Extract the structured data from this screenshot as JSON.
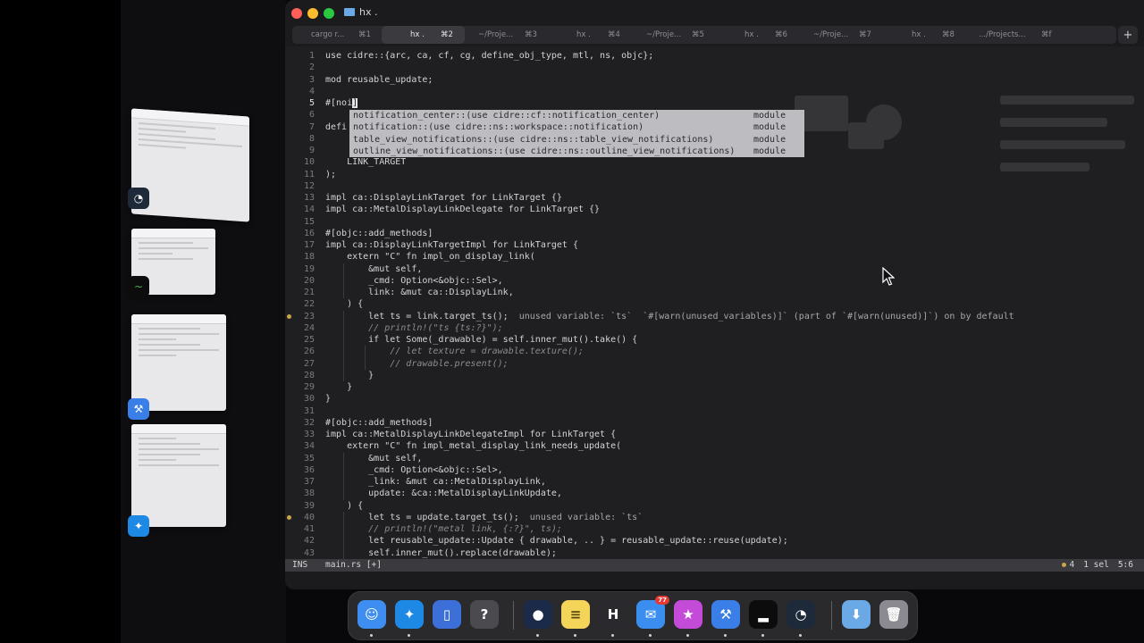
{
  "window": {
    "title": "hx .",
    "new_tab_label": "+"
  },
  "tabs": [
    {
      "label": "cargo r...",
      "shortcut": "⌘1",
      "active": false
    },
    {
      "label": "hx .",
      "shortcut": "⌘2",
      "active": true
    },
    {
      "label": "~/Proje...",
      "shortcut": "⌘3",
      "active": false
    },
    {
      "label": "hx .",
      "shortcut": "⌘4",
      "active": false
    },
    {
      "label": "~/Proje...",
      "shortcut": "⌘5",
      "active": false
    },
    {
      "label": "hx .",
      "shortcut": "⌘6",
      "active": false
    },
    {
      "label": "~/Proje...",
      "shortcut": "⌘7",
      "active": false
    },
    {
      "label": "hx .",
      "shortcut": "⌘8",
      "active": false
    },
    {
      "label": ".../Projects...",
      "shortcut": "⌘f",
      "active": false
    }
  ],
  "code_lines": [
    {
      "n": "1",
      "text": "use cidre::{arc, ca, cf, cg, define_obj_type, mtl, ns, objc};"
    },
    {
      "n": "2",
      "text": ""
    },
    {
      "n": "3",
      "text": "mod reusable_update;"
    },
    {
      "n": "4",
      "text": ""
    },
    {
      "n": "5",
      "text": "#[noi",
      "cursor": "]"
    },
    {
      "n": "6",
      "text": ""
    },
    {
      "n": "7",
      "text": "defi"
    },
    {
      "n": "8",
      "text": ""
    },
    {
      "n": "9",
      "text": ""
    },
    {
      "n": "10",
      "text": "    LINK_TARGET"
    },
    {
      "n": "11",
      "text": ");"
    },
    {
      "n": "12",
      "text": ""
    },
    {
      "n": "13",
      "text": "impl ca::DisplayLinkTarget for LinkTarget {}"
    },
    {
      "n": "14",
      "text": "impl ca::MetalDisplayLinkDelegate for LinkTarget {}"
    },
    {
      "n": "15",
      "text": ""
    },
    {
      "n": "16",
      "text": "#[objc::add_methods]"
    },
    {
      "n": "17",
      "text": "impl ca::DisplayLinkTargetImpl for LinkTarget {"
    },
    {
      "n": "18",
      "text": "    extern \"C\" fn impl_on_display_link("
    },
    {
      "n": "19",
      "text": "        &mut self,"
    },
    {
      "n": "20",
      "text": "        _cmd: Option<&objc::Sel>,"
    },
    {
      "n": "21",
      "text": "        link: &mut ca::DisplayLink,"
    },
    {
      "n": "22",
      "text": "    ) {"
    },
    {
      "n": "23",
      "text": "        let ts = link.target_ts();",
      "hint": "  unused variable: `ts`  `#[warn(unused_variables)]` (part of `#[warn(unused)]`) on by default",
      "diag": true
    },
    {
      "n": "24",
      "text": "        // println!(\"ts {ts:?}\");"
    },
    {
      "n": "25",
      "text": "        if let Some(_drawable) = self.inner_mut().take() {"
    },
    {
      "n": "26",
      "text": "            // let texture = drawable.texture();"
    },
    {
      "n": "27",
      "text": "            // drawable.present();"
    },
    {
      "n": "28",
      "text": "        }"
    },
    {
      "n": "29",
      "text": "    }"
    },
    {
      "n": "30",
      "text": "}"
    },
    {
      "n": "31",
      "text": ""
    },
    {
      "n": "32",
      "text": "#[objc::add_methods]"
    },
    {
      "n": "33",
      "text": "impl ca::MetalDisplayLinkDelegateImpl for LinkTarget {"
    },
    {
      "n": "34",
      "text": "    extern \"C\" fn impl_metal_display_link_needs_update("
    },
    {
      "n": "35",
      "text": "        &mut self,"
    },
    {
      "n": "36",
      "text": "        _cmd: Option<&objc::Sel>,"
    },
    {
      "n": "37",
      "text": "        _link: &mut ca::MetalDisplayLink,"
    },
    {
      "n": "38",
      "text": "        update: &ca::MetalDisplayLinkUpdate,"
    },
    {
      "n": "39",
      "text": "    ) {"
    },
    {
      "n": "40",
      "text": "        let ts = update.target_ts();",
      "hint": "  unused variable: `ts`",
      "diag": true
    },
    {
      "n": "41",
      "text": "        // println!(\"metal link, {:?}\", ts);"
    },
    {
      "n": "42",
      "text": "        let reusable_update::Update { drawable, .. } = reusable_update::reuse(update);"
    },
    {
      "n": "43",
      "text": "        self.inner_mut().replace(drawable);"
    }
  ],
  "completion": [
    {
      "label": "notification_center::(use cidre::cf::notification_center)",
      "kind": "module"
    },
    {
      "label": "notification::(use cidre::ns::workspace::notification)",
      "kind": "module"
    },
    {
      "label": "table_view_notifications::(use cidre::ns::table_view_notifications)",
      "kind": "module"
    },
    {
      "label": "outline_view_notifications::(use cidre::ns::outline_view_notifications)",
      "kind": "module"
    }
  ],
  "status": {
    "mode": "INS",
    "file": "main.rs",
    "modified": "[+]",
    "warnings": "4",
    "selections": "1 sel",
    "position": "5:6"
  },
  "dock": {
    "items": [
      {
        "name": "finder",
        "glyph": "☺",
        "color": "#3d8ef0",
        "dot": true
      },
      {
        "name": "safari",
        "glyph": "✦",
        "color": "#1e88e5",
        "dot": true
      },
      {
        "name": "simulator",
        "glyph": "▯",
        "color": "#3c6fd8",
        "dot": false
      },
      {
        "name": "help",
        "glyph": "?",
        "color": "#4a4a4f",
        "dot": false
      },
      {
        "name": "terminal",
        "glyph": "●",
        "color": "#1c2a4a",
        "dot": true
      },
      {
        "name": "notes",
        "glyph": "≡",
        "color": "#f5d45a",
        "dot": true
      },
      {
        "name": "helix",
        "glyph": "H",
        "color": "#2a2a2e",
        "dot": true
      },
      {
        "name": "mail",
        "glyph": "✉",
        "color": "#3a8ef0",
        "dot": true,
        "badge": "77"
      },
      {
        "name": "instruments",
        "glyph": "★",
        "color": "#c44ad8",
        "dot": true
      },
      {
        "name": "xcode",
        "glyph": "⚒",
        "color": "#3a7ee8",
        "dot": true
      },
      {
        "name": "activity-monitor",
        "glyph": "▂",
        "color": "#0c0c0c",
        "dot": true
      },
      {
        "name": "xcode-beta",
        "glyph": "◔",
        "color": "#1e2a3a",
        "dot": true
      },
      {
        "name": "downloads",
        "glyph": "⬇",
        "color": "#6aa8e6",
        "dot": false
      },
      {
        "name": "trash",
        "glyph": "🗑",
        "color": "#8a8a90",
        "dot": false
      }
    ]
  }
}
